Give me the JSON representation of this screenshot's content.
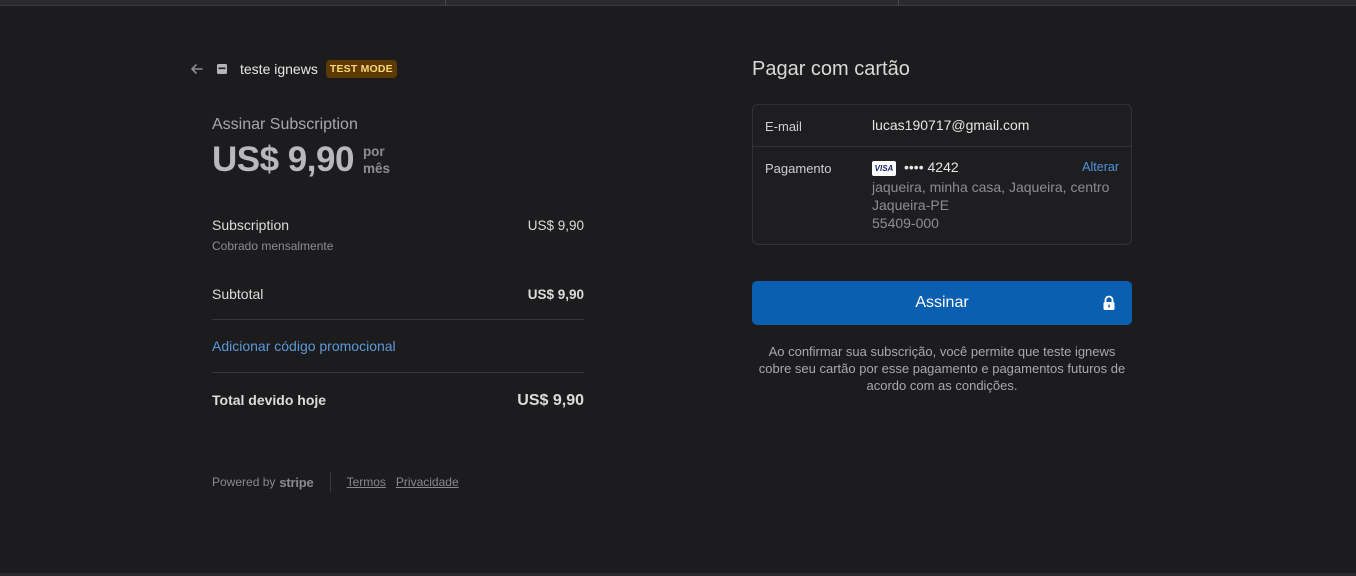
{
  "merchant": {
    "name": "teste ignews",
    "badge": "TEST MODE"
  },
  "product": {
    "title": "Assinar Subscription",
    "price": "US$ 9,90",
    "per_line1": "por",
    "per_line2": "mês"
  },
  "items": {
    "subscription": {
      "label": "Subscription",
      "amount": "US$ 9,90",
      "description": "Cobrado mensalmente"
    },
    "subtotal": {
      "label": "Subtotal",
      "amount": "US$ 9,90"
    },
    "promo_label": "Adicionar código promocional",
    "total": {
      "label": "Total devido hoje",
      "amount": "US$ 9,90"
    }
  },
  "footer": {
    "powered_by": "Powered by",
    "brand": "stripe",
    "terms": "Termos",
    "privacy": "Privacidade"
  },
  "payment": {
    "title": "Pagar com cartão",
    "email_label": "E-mail",
    "email_value": "lucas190717@gmail.com",
    "payment_label": "Pagamento",
    "card_brand": "VISA",
    "card_masked": "•••• 4242",
    "change_label": "Alterar",
    "address_line1": "jaqueira, minha casa, Jaqueira, centro",
    "address_line2": "Jaqueira-PE",
    "address_line3": "55409-000",
    "submit_label": "Assinar",
    "terms_text": "Ao confirmar sua subscrição, você permite que teste ignews cobre seu cartão por esse pagamento e pagamentos futuros de acordo com as condições."
  },
  "colors": {
    "background": "#1c1c1e",
    "accent": "#0b5fb0",
    "link": "#5b9ad8",
    "badge_bg": "#5c3a00",
    "badge_text": "#ffd479"
  },
  "icons": {
    "back": "arrow-left-icon",
    "store": "store-icon",
    "lock": "lock-icon"
  }
}
